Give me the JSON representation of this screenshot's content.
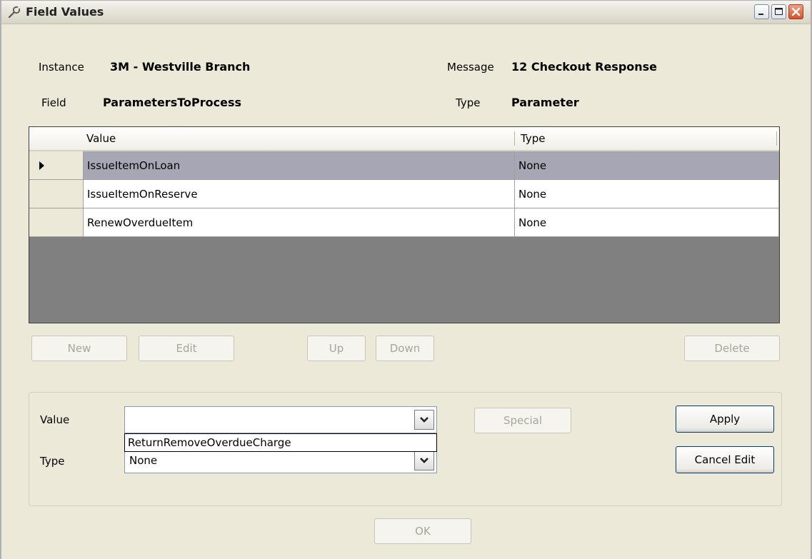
{
  "window": {
    "title": "Field Values"
  },
  "info": {
    "instance_label": "Instance",
    "instance_value": "3M - Westville Branch",
    "message_label": "Message",
    "message_value": "12 Checkout Response",
    "field_label": "Field",
    "field_value": "ParametersToProcess",
    "type_label": "Type",
    "type_value": "Parameter"
  },
  "grid": {
    "columns": [
      "Value",
      "Type"
    ],
    "rows": [
      {
        "value": "IssueItemOnLoan",
        "type": "None"
      },
      {
        "value": "IssueItemOnReserve",
        "type": "None"
      },
      {
        "value": "RenewOverdueItem",
        "type": "None"
      }
    ],
    "selected_row": 0
  },
  "toolbar": {
    "new_label": "New",
    "edit_label": "Edit",
    "up_label": "Up",
    "down_label": "Down",
    "delete_label": "Delete"
  },
  "editor": {
    "value_label": "Value",
    "value_current": "",
    "dropdown_item": "ReturnRemoveOverdueCharge",
    "type_label": "Type",
    "type_current": "None",
    "special_label": "Special",
    "apply_label": "Apply",
    "cancel_label": "Cancel Edit"
  },
  "footer": {
    "ok_label": "OK"
  },
  "colors": {
    "window_bg": "#ece9d8",
    "grid_bg": "#808080",
    "selected_row": "#a6a6b4",
    "close_button": "#d8502c"
  },
  "icons": {
    "app": "wrench-icon",
    "minimize": "minimize-icon",
    "maximize": "maximize-icon",
    "close": "close-icon",
    "row_indicator": "row-arrow-icon",
    "combo": "chevron-down-icon"
  }
}
